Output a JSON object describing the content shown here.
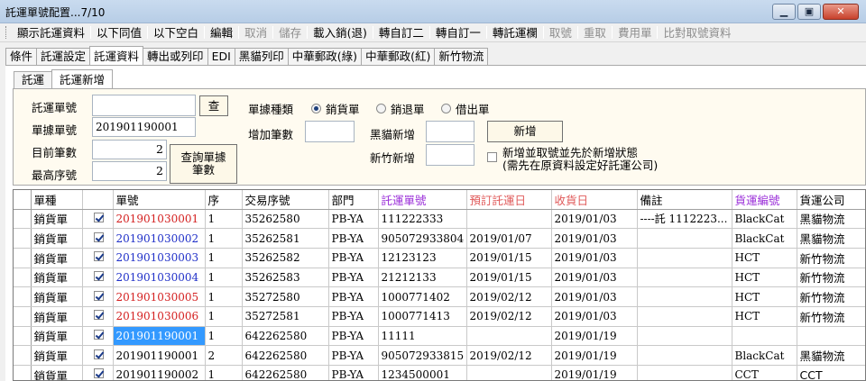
{
  "window": {
    "title": "託運單號配置...7/10",
    "controls": [
      "▁",
      "▣",
      "✕"
    ]
  },
  "toolbar": [
    {
      "label": "顯示託運資料",
      "disabled": false
    },
    {
      "label": "以下同值",
      "disabled": false
    },
    {
      "label": "以下空白",
      "disabled": false
    },
    {
      "label": "編輯",
      "disabled": false
    },
    {
      "label": "取消",
      "disabled": true
    },
    {
      "label": "儲存",
      "disabled": true
    },
    {
      "label": "載入銷(退)",
      "disabled": false
    },
    {
      "label": "轉自訂二",
      "disabled": false
    },
    {
      "label": "轉自訂一",
      "disabled": false
    },
    {
      "label": "轉託運欄",
      "disabled": false
    },
    {
      "label": "取號",
      "disabled": true
    },
    {
      "label": "重取",
      "disabled": true
    },
    {
      "label": "費用單",
      "disabled": true
    },
    {
      "label": "比對取號資料",
      "disabled": true
    }
  ],
  "main_tabs": [
    {
      "label": "條件",
      "active": false
    },
    {
      "label": "託運設定",
      "active": false
    },
    {
      "label": "託運資料",
      "active": true
    },
    {
      "label": "轉出或列印",
      "active": false
    },
    {
      "label": "EDI",
      "active": false
    },
    {
      "label": "黑貓列印",
      "active": false
    },
    {
      "label": "中華郵政(綠)",
      "active": false
    },
    {
      "label": "中華郵政(紅)",
      "active": false
    },
    {
      "label": "新竹物流",
      "active": false
    }
  ],
  "sub_tabs": [
    {
      "label": "託運",
      "active": false
    },
    {
      "label": "託運新增",
      "active": true
    }
  ],
  "form": {
    "tracking_no_label": "託運單號",
    "tracking_no_value": "",
    "search_button": "查",
    "doc_no_label": "單據單號",
    "doc_no_value": "201901190001",
    "count_label": "目前筆數",
    "count_value": "2",
    "max_seq_label": "最高序號",
    "max_seq_value": "2",
    "query_button": "查詢單據筆數",
    "doc_type_label": "單據種類",
    "doc_types": [
      {
        "label": "銷貨單",
        "checked": true
      },
      {
        "label": "銷退單",
        "checked": false
      },
      {
        "label": "借出單",
        "checked": false
      }
    ],
    "add_count_label": "增加筆數",
    "add_count_value": "",
    "blackcat_label": "黑貓新增",
    "blackcat_value": "",
    "hsinchu_label": "新竹新增",
    "hsinchu_value": "",
    "add_button": "新增",
    "add_take_label": "新增並取號並先於新增狀態",
    "add_take_note": "(需先在原資料設定好託運公司)",
    "add_take_checked": false
  },
  "grid": {
    "columns": [
      {
        "label": "單種",
        "color": "#000000"
      },
      {
        "label": "",
        "color": "#000000"
      },
      {
        "label": "單號",
        "color": "#000000"
      },
      {
        "label": "序",
        "color": "#000000"
      },
      {
        "label": "交易序號",
        "color": "#000000"
      },
      {
        "label": "部門",
        "color": "#000000"
      },
      {
        "label": "託運單號",
        "color": "#9b30d9"
      },
      {
        "label": "預訂託運日",
        "color": "#e05a5a"
      },
      {
        "label": "收貨日",
        "color": "#e05a5a"
      },
      {
        "label": "備註",
        "color": "#000000"
      },
      {
        "label": "貨運編號",
        "color": "#9b30d9"
      },
      {
        "label": "貨運公司",
        "color": "#000000"
      }
    ],
    "rows": [
      {
        "type": "銷貨單",
        "checked": true,
        "no": "201901030001",
        "no_color": "#d42020",
        "seq": "1",
        "txn": "35262580",
        "dept": "PB-YA",
        "tracking": "111222333",
        "planned": "",
        "received": "2019/01/03",
        "note": "----託  1112223...",
        "carrier_code": "BlackCat",
        "carrier": "黑貓物流"
      },
      {
        "type": "銷貨單",
        "checked": true,
        "no": "201901030002",
        "no_color": "#2030c8",
        "seq": "1",
        "txn": "35262581",
        "dept": "PB-YA",
        "tracking": "905072933804",
        "planned": "2019/01/07",
        "received": "2019/01/03",
        "note": "",
        "carrier_code": "BlackCat",
        "carrier": "黑貓物流"
      },
      {
        "type": "銷貨單",
        "checked": true,
        "no": "201901030003",
        "no_color": "#2030c8",
        "seq": "1",
        "txn": "35262582",
        "dept": "PB-YA",
        "tracking": "12123123",
        "planned": "2019/01/15",
        "received": "2019/01/03",
        "note": "",
        "carrier_code": "HCT",
        "carrier": "新竹物流"
      },
      {
        "type": "銷貨單",
        "checked": true,
        "no": "201901030004",
        "no_color": "#2030c8",
        "seq": "1",
        "txn": "35262583",
        "dept": "PB-YA",
        "tracking": "21212133",
        "planned": "2019/01/15",
        "received": "2019/01/03",
        "note": "",
        "carrier_code": "HCT",
        "carrier": "新竹物流"
      },
      {
        "type": "銷貨單",
        "checked": true,
        "no": "201901030005",
        "no_color": "#d42020",
        "seq": "1",
        "txn": "35272580",
        "dept": "PB-YA",
        "tracking": "1000771402",
        "planned": "2019/02/12",
        "received": "2019/01/03",
        "note": "",
        "carrier_code": "HCT",
        "carrier": "新竹物流"
      },
      {
        "type": "銷貨單",
        "checked": true,
        "no": "201901030006",
        "no_color": "#d42020",
        "seq": "1",
        "txn": "35272581",
        "dept": "PB-YA",
        "tracking": "1000771413",
        "planned": "2019/02/12",
        "received": "2019/01/03",
        "note": "",
        "carrier_code": "HCT",
        "carrier": "新竹物流"
      },
      {
        "type": "銷貨單",
        "checked": true,
        "no": "201901190001",
        "no_color": "#ffffff",
        "selected": true,
        "seq": "1",
        "txn": "642262580",
        "dept": "PB-YA",
        "tracking": "11111",
        "planned": "",
        "received": "2019/01/19",
        "note": "",
        "carrier_code": "",
        "carrier": ""
      },
      {
        "type": "銷貨單",
        "checked": true,
        "no": "201901190001",
        "no_color": "#000000",
        "seq": "2",
        "txn": "642262580",
        "dept": "PB-YA",
        "tracking": "905072933815",
        "planned": "2019/02/12",
        "received": "2019/01/19",
        "note": "",
        "carrier_code": "BlackCat",
        "carrier": "黑貓物流"
      },
      {
        "type": "銷貨單",
        "checked": true,
        "no": "201901190002",
        "no_color": "#000000",
        "seq": "1",
        "txn": "642262580",
        "dept": "PB-YA",
        "tracking": "1234500001",
        "planned": "",
        "received": "2019/01/19",
        "note": "",
        "carrier_code": "CCT",
        "carrier": "CCT"
      }
    ]
  }
}
